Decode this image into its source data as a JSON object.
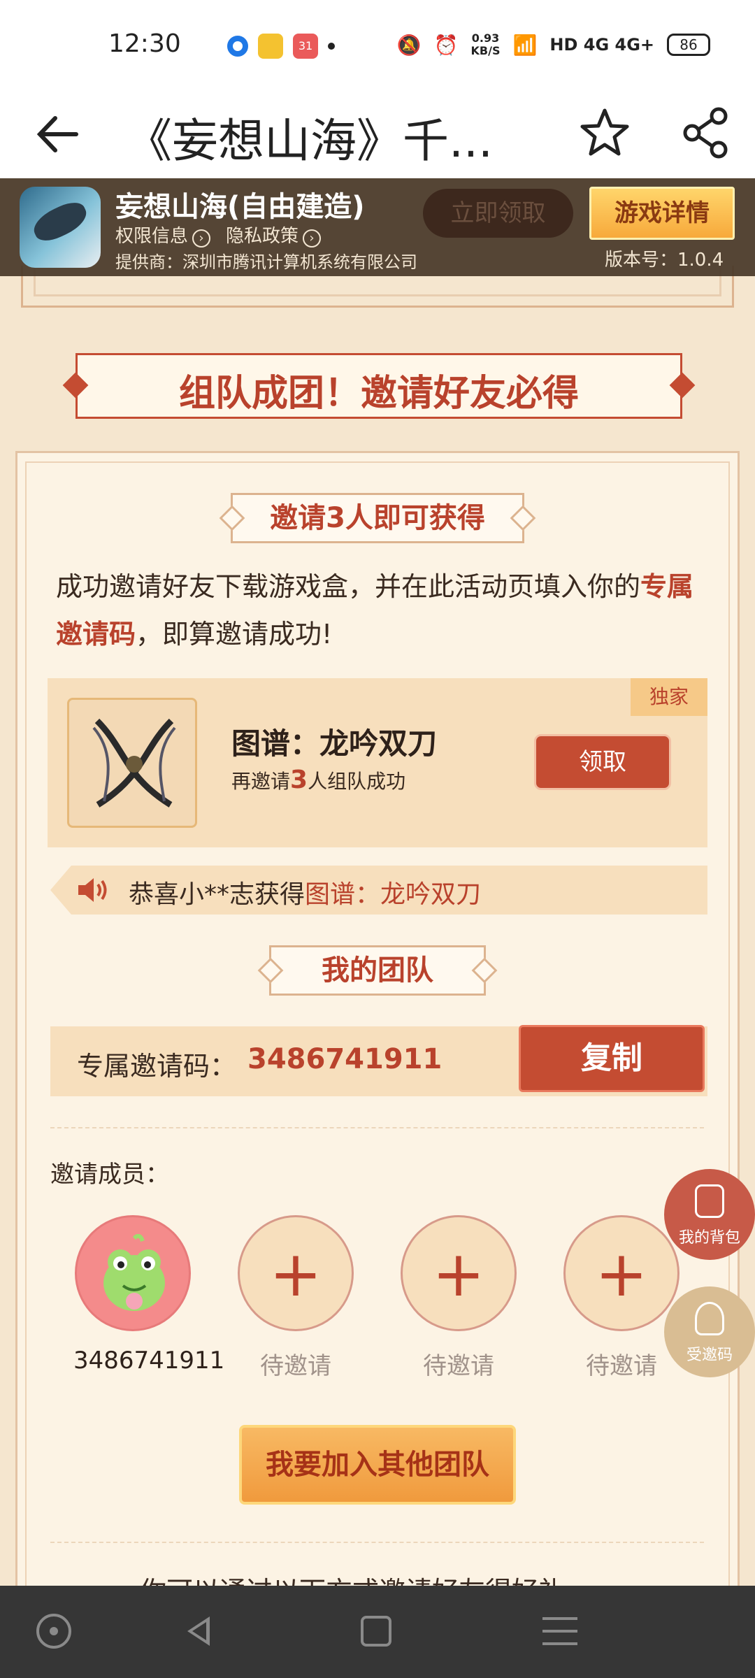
{
  "status": {
    "time": "12:30",
    "net_speed_value": "0.93",
    "net_speed_unit": "KB/S",
    "network": "HD 4G 4G+",
    "battery": "86",
    "calendar_badge": "31"
  },
  "header": {
    "back_icon": "arrow-left-icon",
    "title": "《妄想山海》千...",
    "star_icon": "star-icon",
    "share_icon": "share-icon"
  },
  "app_info": {
    "name": "妄想山海(自由建造)",
    "permissions": "权限信息",
    "privacy": "隐私政策",
    "provider": "提供商：深圳市腾讯计算机系统有限公司",
    "claim_now": "立即领取",
    "detail_button": "游戏详情",
    "version": "版本号：1.0.4"
  },
  "banner": {
    "title": "组队成团！邀请好友必得"
  },
  "invite": {
    "subtitle": "邀请3人即可获得",
    "desc_part1": "成功邀请好友下载游戏盒，并在此活动页填入你的",
    "desc_highlight": "专属邀请码",
    "desc_part2": "，即算邀请成功!"
  },
  "reward": {
    "tag": "独家",
    "name": "图谱：龙吟双刀",
    "cond_prefix": "再邀请",
    "cond_count": "3",
    "cond_suffix": "人组队成功",
    "claim_label": "领取"
  },
  "notice": {
    "prefix": "恭喜小**志获得",
    "item": "图谱：龙吟双刀"
  },
  "team": {
    "subtitle": "我的团队",
    "code_label": "专属邀请码：",
    "code_value": "3486741911",
    "copy_label": "复制",
    "members_label": "邀请成员：",
    "members": [
      {
        "name": "3486741911"
      },
      {
        "name": "待邀请"
      },
      {
        "name": "待邀请"
      },
      {
        "name": "待邀请"
      }
    ],
    "join_label": "我要加入其他团队"
  },
  "footer_text": "你可以通过以下方式邀请好友得好礼",
  "floating": {
    "bag_label": "我的背包",
    "code_label": "受邀码"
  },
  "colors": {
    "accent": "#b9422c",
    "background": "#f5e6cf",
    "card": "#fcf3e4",
    "button_gold": "#f09a3d"
  }
}
